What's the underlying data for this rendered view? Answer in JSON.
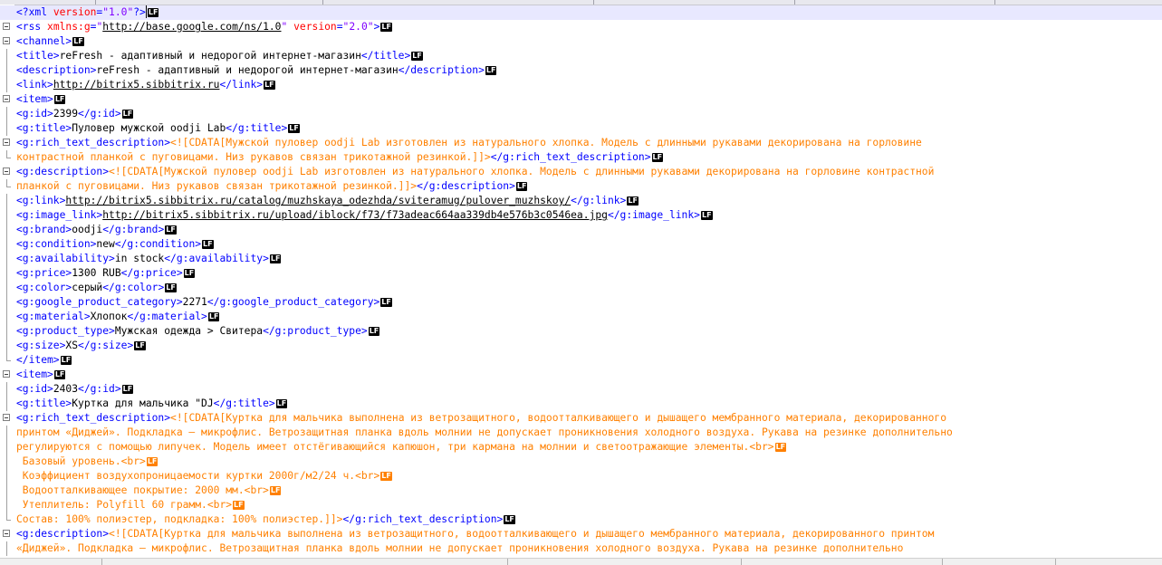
{
  "editor": {
    "lf_marker": "LF",
    "lines": [
      {
        "fold": "none",
        "active": true,
        "caret": true,
        "segs": [
          {
            "k": "t",
            "s": "<?xml "
          },
          {
            "k": "a",
            "s": "version"
          },
          {
            "k": "t",
            "s": "="
          },
          {
            "k": "v",
            "s": "\"1.0\""
          },
          {
            "k": "t",
            "s": "?>"
          }
        ],
        "lf": "black"
      },
      {
        "fold": "box",
        "segs": [
          {
            "k": "t",
            "s": "<rss "
          },
          {
            "k": "a",
            "s": "xmlns:g"
          },
          {
            "k": "t",
            "s": "="
          },
          {
            "k": "v",
            "s": "\""
          },
          {
            "k": "u",
            "s": "http://base.google.com/ns/1.0"
          },
          {
            "k": "v",
            "s": "\""
          },
          {
            "k": "x",
            "s": " "
          },
          {
            "k": "a",
            "s": "version"
          },
          {
            "k": "t",
            "s": "="
          },
          {
            "k": "v",
            "s": "\"2.0\""
          },
          {
            "k": "t",
            "s": ">"
          }
        ],
        "lf": "black"
      },
      {
        "fold": "box",
        "segs": [
          {
            "k": "t",
            "s": "<channel>"
          }
        ],
        "lf": "black"
      },
      {
        "fold": "line",
        "segs": [
          {
            "k": "t",
            "s": "<title>"
          },
          {
            "k": "x",
            "s": "reFresh - адаптивный и недорогой интернет-магазин"
          },
          {
            "k": "t",
            "s": "</title>"
          }
        ],
        "lf": "black"
      },
      {
        "fold": "line",
        "segs": [
          {
            "k": "t",
            "s": "<description>"
          },
          {
            "k": "x",
            "s": "reFresh - адаптивный и недорогой интернет-магазин"
          },
          {
            "k": "t",
            "s": "</description>"
          }
        ],
        "lf": "black"
      },
      {
        "fold": "line",
        "segs": [
          {
            "k": "t",
            "s": "<link>"
          },
          {
            "k": "u",
            "s": "http://bitrix5.sibbitrix.ru"
          },
          {
            "k": "t",
            "s": "</link>"
          }
        ],
        "lf": "black"
      },
      {
        "fold": "box",
        "segs": [
          {
            "k": "t",
            "s": "<item>"
          }
        ],
        "lf": "black"
      },
      {
        "fold": "line",
        "segs": [
          {
            "k": "t",
            "s": "<g:id>"
          },
          {
            "k": "x",
            "s": "2399"
          },
          {
            "k": "t",
            "s": "</g:id>"
          }
        ],
        "lf": "black"
      },
      {
        "fold": "line",
        "segs": [
          {
            "k": "t",
            "s": "<g:title>"
          },
          {
            "k": "x",
            "s": "Пуловер мужской oodji Lab"
          },
          {
            "k": "t",
            "s": "</g:title>"
          }
        ],
        "lf": "black"
      },
      {
        "fold": "box",
        "segs": [
          {
            "k": "t",
            "s": "<g:rich_text_description>"
          },
          {
            "k": "c",
            "s": "<![CDATA[Мужской пуловер oodji Lab изготовлен из натурального хлопка. Модель с длинными рукавами декорирована на горловине"
          }
        ],
        "lf": "none"
      },
      {
        "fold": "end",
        "segs": [
          {
            "k": "c",
            "s": "контрастной планкой с пуговицами. Низ рукавов связан трикотажной резинкой.]]>"
          },
          {
            "k": "t",
            "s": "</g:rich_text_description>"
          }
        ],
        "lf": "black"
      },
      {
        "fold": "box",
        "segs": [
          {
            "k": "t",
            "s": "<g:description>"
          },
          {
            "k": "c",
            "s": "<![CDATA[Мужской пуловер oodji Lab изготовлен из натурального хлопка. Модель с длинными рукавами декорирована на горловине контрастной"
          }
        ],
        "lf": "none"
      },
      {
        "fold": "end",
        "segs": [
          {
            "k": "c",
            "s": "планкой с пуговицами. Низ рукавов связан трикотажной резинкой.]]>"
          },
          {
            "k": "t",
            "s": "</g:description>"
          }
        ],
        "lf": "black"
      },
      {
        "fold": "line",
        "segs": [
          {
            "k": "t",
            "s": "<g:link>"
          },
          {
            "k": "u",
            "s": "http://bitrix5.sibbitrix.ru/catalog/muzhskaya_odezhda/sviteramug/pulover_muzhskoy/"
          },
          {
            "k": "t",
            "s": "</g:link>"
          }
        ],
        "lf": "black"
      },
      {
        "fold": "line",
        "segs": [
          {
            "k": "t",
            "s": "<g:image_link>"
          },
          {
            "k": "u",
            "s": "http://bitrix5.sibbitrix.ru/upload/iblock/f73/f73adeac664aa339db4e576b3c0546ea.jpg"
          },
          {
            "k": "t",
            "s": "</g:image_link>"
          }
        ],
        "lf": "black"
      },
      {
        "fold": "line",
        "segs": [
          {
            "k": "t",
            "s": "<g:brand>"
          },
          {
            "k": "x",
            "s": "oodji"
          },
          {
            "k": "t",
            "s": "</g:brand>"
          }
        ],
        "lf": "black"
      },
      {
        "fold": "line",
        "segs": [
          {
            "k": "t",
            "s": "<g:condition>"
          },
          {
            "k": "x",
            "s": "new"
          },
          {
            "k": "t",
            "s": "</g:condition>"
          }
        ],
        "lf": "black"
      },
      {
        "fold": "line",
        "segs": [
          {
            "k": "t",
            "s": "<g:availability>"
          },
          {
            "k": "x",
            "s": "in stock"
          },
          {
            "k": "t",
            "s": "</g:availability>"
          }
        ],
        "lf": "black"
      },
      {
        "fold": "line",
        "segs": [
          {
            "k": "t",
            "s": "<g:price>"
          },
          {
            "k": "x",
            "s": "1300 RUB"
          },
          {
            "k": "t",
            "s": "</g:price>"
          }
        ],
        "lf": "black"
      },
      {
        "fold": "line",
        "segs": [
          {
            "k": "t",
            "s": "<g:color>"
          },
          {
            "k": "x",
            "s": "серый"
          },
          {
            "k": "t",
            "s": "</g:color>"
          }
        ],
        "lf": "black"
      },
      {
        "fold": "line",
        "segs": [
          {
            "k": "t",
            "s": "<g:google_product_category>"
          },
          {
            "k": "x",
            "s": "2271"
          },
          {
            "k": "t",
            "s": "</g:google_product_category>"
          }
        ],
        "lf": "black"
      },
      {
        "fold": "line",
        "segs": [
          {
            "k": "t",
            "s": "<g:material>"
          },
          {
            "k": "x",
            "s": "Хлопок"
          },
          {
            "k": "t",
            "s": "</g:material>"
          }
        ],
        "lf": "black"
      },
      {
        "fold": "line",
        "segs": [
          {
            "k": "t",
            "s": "<g:product_type>"
          },
          {
            "k": "x",
            "s": "Мужская одежда > Свитера"
          },
          {
            "k": "t",
            "s": "</g:product_type>"
          }
        ],
        "lf": "black"
      },
      {
        "fold": "line",
        "segs": [
          {
            "k": "t",
            "s": "<g:size>"
          },
          {
            "k": "x",
            "s": "XS"
          },
          {
            "k": "t",
            "s": "</g:size>"
          }
        ],
        "lf": "black"
      },
      {
        "fold": "end",
        "segs": [
          {
            "k": "t",
            "s": "</item>"
          }
        ],
        "lf": "black"
      },
      {
        "fold": "box",
        "segs": [
          {
            "k": "t",
            "s": "<item>"
          }
        ],
        "lf": "black"
      },
      {
        "fold": "line",
        "segs": [
          {
            "k": "t",
            "s": "<g:id>"
          },
          {
            "k": "x",
            "s": "2403"
          },
          {
            "k": "t",
            "s": "</g:id>"
          }
        ],
        "lf": "black"
      },
      {
        "fold": "line",
        "segs": [
          {
            "k": "t",
            "s": "<g:title>"
          },
          {
            "k": "x",
            "s": "Куртка для мальчика \"DJ"
          },
          {
            "k": "t",
            "s": "</g:title>"
          }
        ],
        "lf": "black"
      },
      {
        "fold": "box",
        "segs": [
          {
            "k": "t",
            "s": "<g:rich_text_description>"
          },
          {
            "k": "c",
            "s": "<![CDATA[Куртка для мальчика выполнена из ветрозащитного, водоотталкивающего и дышащего мембранного материала, декорированного"
          }
        ],
        "lf": "none"
      },
      {
        "fold": "line",
        "segs": [
          {
            "k": "c",
            "s": "принтом «Диджей». Подкладка – микрофлис. Ветрозащитная планка вдоль молнии не допускает проникновения холодного воздуха. Рукава на резинке дополнительно"
          }
        ],
        "lf": "none"
      },
      {
        "fold": "line",
        "segs": [
          {
            "k": "c",
            "s": "регулируются с помощью липучек. Модель имеет отстёгивающийся капюшон, три кармана на молнии и светоотражающие элементы.<br>"
          }
        ],
        "lf": "orange"
      },
      {
        "fold": "line",
        "segs": [
          {
            "k": "c",
            "s": " Базовый уровень.<br>"
          }
        ],
        "lf": "orange"
      },
      {
        "fold": "line",
        "segs": [
          {
            "k": "c",
            "s": " Коэффициент воздухопроницаемости куртки 2000г/м2/24 ч.<br>"
          }
        ],
        "lf": "orange"
      },
      {
        "fold": "line",
        "segs": [
          {
            "k": "c",
            "s": " Водоотталкивающее покрытие: 2000 мм.<br>"
          }
        ],
        "lf": "orange"
      },
      {
        "fold": "line",
        "segs": [
          {
            "k": "c",
            "s": " Утеплитель: Polyfill 60 грамм.<br>"
          }
        ],
        "lf": "orange"
      },
      {
        "fold": "end",
        "segs": [
          {
            "k": "c",
            "s": "Состав: 100% полиэстер, подкладка: 100% полиэстер.]]>"
          },
          {
            "k": "t",
            "s": "</g:rich_text_description>"
          }
        ],
        "lf": "black"
      },
      {
        "fold": "box",
        "segs": [
          {
            "k": "t",
            "s": "<g:description>"
          },
          {
            "k": "c",
            "s": "<![CDATA[Куртка для мальчика выполнена из ветрозащитного, водоотталкивающего и дышащего мембранного материала, декорированного принтом"
          }
        ],
        "lf": "none"
      },
      {
        "fold": "line",
        "segs": [
          {
            "k": "c",
            "s": "«Диджей». Подкладка – микрофлис. Ветрозащитная планка вдоль молнии не допускает проникновения холодного воздуха. Рукава на резинке дополнительно"
          }
        ],
        "lf": "none"
      }
    ]
  }
}
